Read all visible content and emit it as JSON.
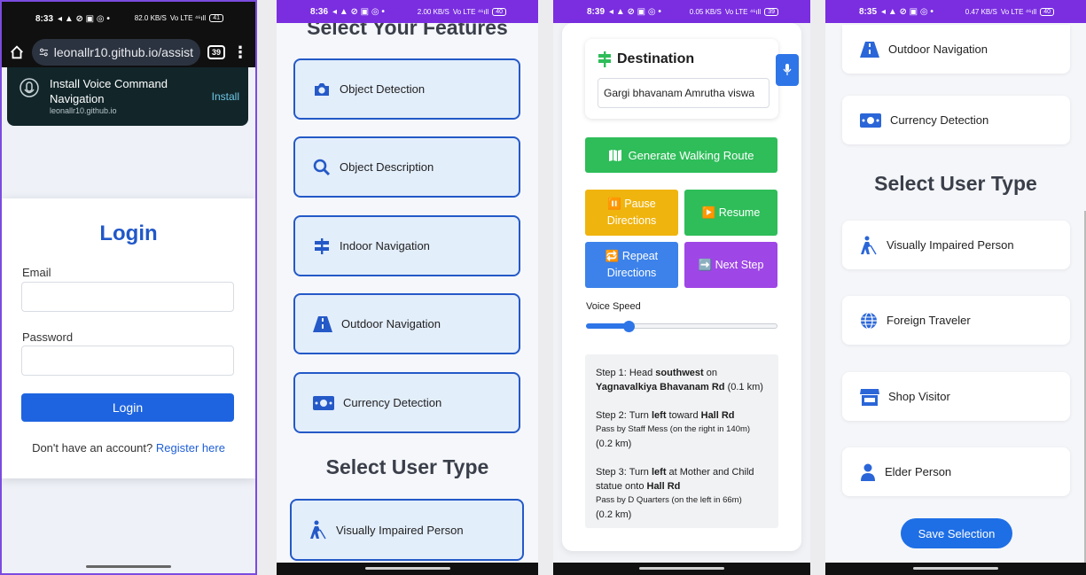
{
  "status": {
    "p1_time": "8:33",
    "p1_right": "82.0 KB/S",
    "p1_batt": "41",
    "p2_time": "8:36",
    "p2_right": "2.00 KB/S",
    "p2_batt": "40",
    "p3_time": "8:39",
    "p3_right": "0.05 KB/S",
    "p3_batt": "39",
    "p4_time": "8:35",
    "p4_right": "0.47 KB/S",
    "p4_batt": "40",
    "signal": "Vo LTE ⁴⁶ıll"
  },
  "panel1": {
    "url": "leonallr10.github.io/assist",
    "tab_count": "39",
    "install": {
      "title": "Install Voice Command Navigation",
      "domain": "leonallr10.github.io",
      "button": "Install"
    },
    "login": {
      "title": "Login",
      "email_label": "Email",
      "password_label": "Password",
      "button": "Login",
      "register_prompt": "Don't have an account?",
      "register_link": "Register here"
    }
  },
  "panel2": {
    "features_title": "Select Your Features",
    "features": [
      {
        "label": "Object Detection",
        "icon": "camera-icon"
      },
      {
        "label": "Object Description",
        "icon": "search-icon"
      },
      {
        "label": "Indoor Navigation",
        "icon": "signpost-icon"
      },
      {
        "label": "Outdoor Navigation",
        "icon": "road-icon"
      },
      {
        "label": "Currency Detection",
        "icon": "money-icon"
      }
    ],
    "user_type_title": "Select User Type",
    "user_type_first": "Visually Impaired Person"
  },
  "panel3": {
    "destination_title": "Destination",
    "destination_value": "Gargi bhavanam Amrutha viswa",
    "generate_button": "Generate Walking Route",
    "pause_button": "⏸️ Pause Directions",
    "resume_button": "▶️ Resume",
    "repeat_button": "🔁 Repeat Directions",
    "next_button": "➡️ Next Step",
    "voice_speed_label": "Voice Speed",
    "voice_speed_fraction": 0.22,
    "colors": {
      "generate": "#2ebd59",
      "pause": "#f0b40e",
      "resume": "#2ebd59",
      "repeat": "#3c82ea",
      "next": "#9f46e6"
    },
    "steps": [
      {
        "prefix": "Step 1: Head ",
        "dir": "southwest",
        "mid": " on ",
        "road": "Yagnavalkiya Bhavanam Rd",
        "dist": " (0.1 km)",
        "note": "",
        "dist2": ""
      },
      {
        "prefix": "Step 2: Turn ",
        "dir": "left",
        "mid": " toward ",
        "road": "Hall Rd",
        "dist": "",
        "note": "Pass by Staff Mess (on the right in 140m)",
        "dist2": "(0.2 km)"
      },
      {
        "prefix": "Step 3: Turn ",
        "dir": "left",
        "mid": " at Mother and Child statue onto ",
        "road": "Hall Rd",
        "dist": "",
        "note": "Pass by D Quarters (on the left in 66m)",
        "dist2": "(0.2 km)"
      }
    ]
  },
  "panel4": {
    "features": [
      {
        "label": "Outdoor Navigation",
        "icon": "road-icon"
      },
      {
        "label": "Currency Detection",
        "icon": "money-icon"
      }
    ],
    "user_type_title": "Select User Type",
    "user_types": [
      {
        "label": "Visually Impaired Person",
        "icon": "blind-person-icon"
      },
      {
        "label": "Foreign Traveler",
        "icon": "globe-icon"
      },
      {
        "label": "Shop Visitor",
        "icon": "store-icon"
      },
      {
        "label": "Elder Person",
        "icon": "person-icon"
      }
    ],
    "save_button": "Save Selection"
  }
}
